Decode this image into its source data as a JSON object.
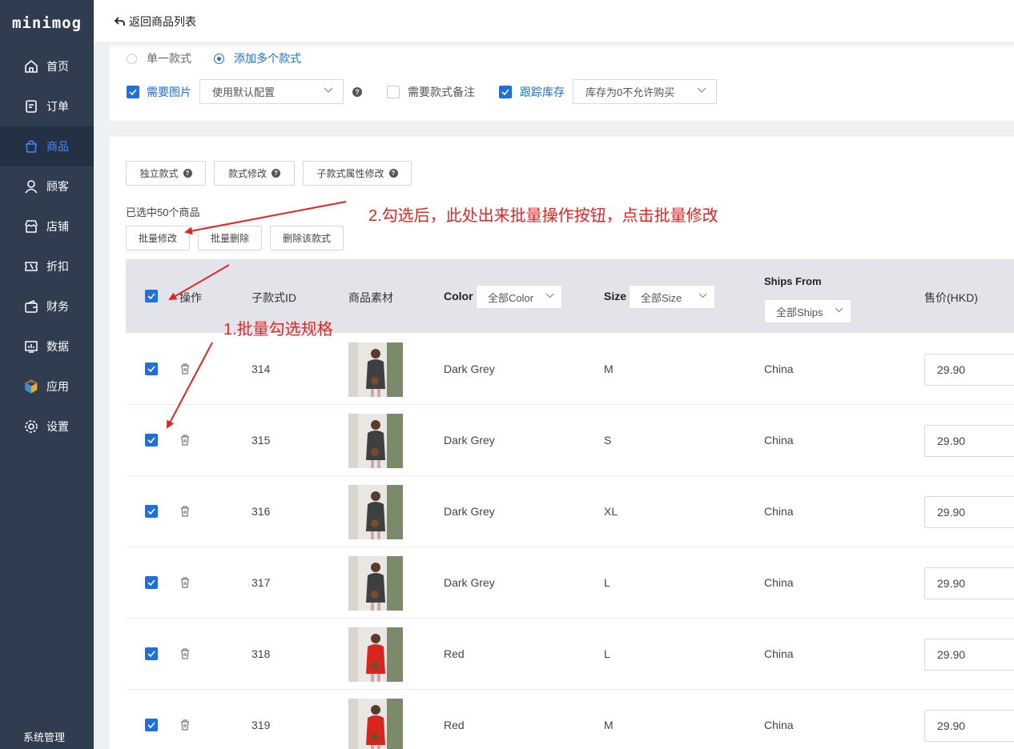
{
  "app": {
    "logo": "minimog"
  },
  "sidebar": {
    "items": [
      {
        "label": "首页",
        "icon": "home-icon",
        "active": false
      },
      {
        "label": "订单",
        "icon": "order-icon",
        "active": false
      },
      {
        "label": "商品",
        "icon": "bag-icon",
        "active": true
      },
      {
        "label": "顾客",
        "icon": "user-icon",
        "active": false
      },
      {
        "label": "店铺",
        "icon": "store-icon",
        "active": false
      },
      {
        "label": "折扣",
        "icon": "ticket-icon",
        "active": false
      },
      {
        "label": "财务",
        "icon": "wallet-icon",
        "active": false
      },
      {
        "label": "数据",
        "icon": "chart-icon",
        "active": false
      },
      {
        "label": "应用",
        "icon": "cube-icon",
        "active": false
      },
      {
        "label": "设置",
        "icon": "gear-icon",
        "active": false
      }
    ],
    "system": "系统管理"
  },
  "header": {
    "back_label": "返回商品列表"
  },
  "config": {
    "radio_single": "单一款式",
    "radio_multi": "添加多个款式",
    "need_image": "需要图片",
    "image_select": "使用默认配置",
    "need_note": "需要款式备注",
    "track_stock": "跟踪库存",
    "stock_select": "库存为0不允许购买"
  },
  "toolbar": {
    "independent": "独立款式",
    "modify": "款式修改",
    "sub_modify": "子款式属性修改"
  },
  "selection": {
    "count_text": "已选中50个商品",
    "bulk_edit": "批量修改",
    "bulk_delete": "批量删除",
    "delete_variant": "删除该款式"
  },
  "table": {
    "headers": {
      "action": "操作",
      "sub_id": "子款式ID",
      "material": "商品素材",
      "color": "Color",
      "color_filter": "全部Color",
      "size": "Size",
      "size_filter": "全部Size",
      "ships": "Ships From",
      "ships_filter": "全部Ships",
      "price": "售价(HKD)"
    },
    "rows": [
      {
        "id": "314",
        "color": "Dark Grey",
        "size": "M",
        "ships": "China",
        "price": "29.90",
        "swatch": "#3e3f3f"
      },
      {
        "id": "315",
        "color": "Dark Grey",
        "size": "S",
        "ships": "China",
        "price": "29.90",
        "swatch": "#3e3f3f"
      },
      {
        "id": "316",
        "color": "Dark Grey",
        "size": "XL",
        "ships": "China",
        "price": "29.90",
        "swatch": "#3e3f3f"
      },
      {
        "id": "317",
        "color": "Dark Grey",
        "size": "L",
        "ships": "China",
        "price": "29.90",
        "swatch": "#3e3f3f"
      },
      {
        "id": "318",
        "color": "Red",
        "size": "L",
        "ships": "China",
        "price": "29.90",
        "swatch": "#d8261f"
      },
      {
        "id": "319",
        "color": "Red",
        "size": "M",
        "ships": "China",
        "price": "29.90",
        "swatch": "#d8261f"
      }
    ]
  },
  "annotations": {
    "step1": "1.批量勾选规格",
    "step2": "2.勾选后，此处出来批量操作按钮，点击批量修改"
  },
  "colors": {
    "accent": "#1e6fe0",
    "sidebar": "#303c4f",
    "annotation": "#e52421"
  }
}
